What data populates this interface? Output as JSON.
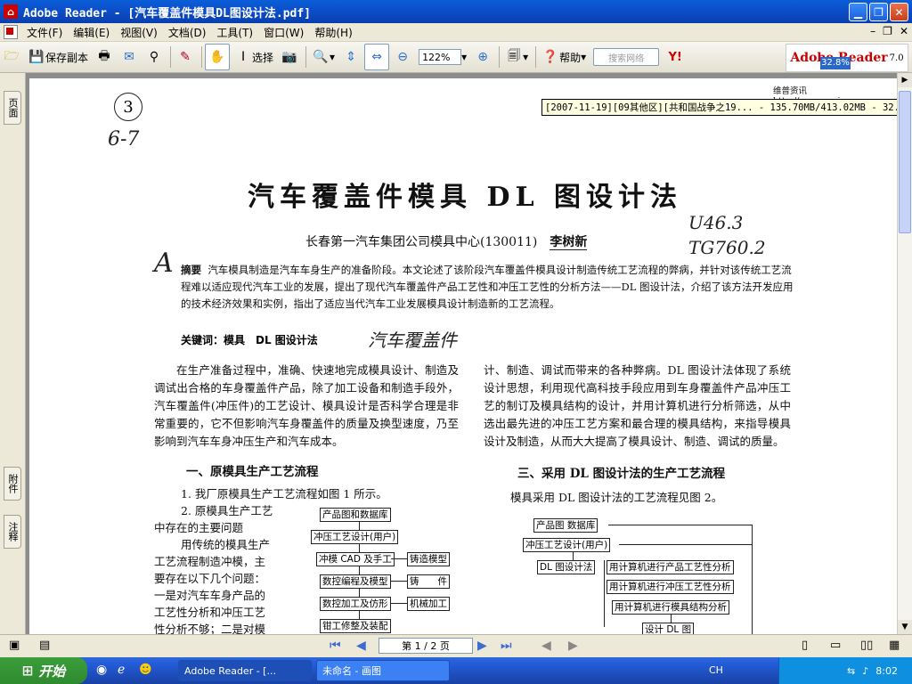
{
  "window": {
    "title": "Adobe Reader - [汽车覆盖件模具DL图设计法.pdf]"
  },
  "menu": [
    "文件(F)",
    "编辑(E)",
    "视图(V)",
    "文档(D)",
    "工具(T)",
    "窗口(W)",
    "帮助(H)"
  ],
  "toolbar": {
    "save_copy": "保存副本",
    "select": "选择",
    "zoom": "122%",
    "help": "帮助",
    "search_placeholder": "搜索网络",
    "logo_brand": "Adobe Reader",
    "logo_version": "7.0"
  },
  "side_tabs": [
    "页面",
    "附件",
    "注释"
  ],
  "overlay": {
    "zoom_indicator": "32.8%",
    "tooltip": "[2007-11-19][09其他区][共和国战争之19... - 135.70MB/413.02MB - 32.8%]",
    "vip_site": "维普资讯 http://www.cqvip.com"
  },
  "handwriting": {
    "circled": "3",
    "page_range": "6-7",
    "code1": "U46.3",
    "code2": "TG760.2",
    "letter": "A",
    "keyword_note": "汽车覆盖件"
  },
  "paper": {
    "title": "汽车覆盖件模具 DL 图设计法",
    "affiliation": "长春第一汽车集团公司模具中心(130011)",
    "author": "李树新",
    "abstract_label": "摘要",
    "abstract": "汽车模具制造是汽车车身生产的准备阶段。本文论述了该阶段汽车覆盖件模具设计制造传统工艺流程的弊病，并针对该传统工艺流程难以适应现代汽车工业的发展，提出了现代汽车覆盖件产品工艺性和冲压工艺性的分析方法——DL 图设计法，介绍了该方法开发应用的技术经济效果和实例，指出了适应当代汽车工业发展模具设计制造新的工艺流程。",
    "keywords": "关键词：模具　DL 图设计法",
    "intro_left": "在生产准备过程中，准确、快速地完成模具设计、制造及调试出合格的车身覆盖件产品，除了加工设备和制造手段外，汽车覆盖件(冲压件)的工艺设计、模具设计是否科学合理是非常重要的，它不但影响汽车身覆盖件的质量及换型速度，乃至影响到汽车车身冲压生产和汽车成本。",
    "intro_right": "计、制造、调试而带来的各种弊病。DL 图设计法体现了系统设计思想，利用现代高科技手段应用到车身覆盖件产品冲压工艺的制订及模具结构的设计，并用计算机进行分析筛选，从中选出最先进的冲压工艺方案和最合理的模具结构，来指导模具设计及制造，从而大大提高了模具设计、制造、调试的质量。",
    "sec1": "一、原模具生产工艺流程",
    "sec1_p1": "1. 我厂原模具生产工艺流程如图 1 所示。",
    "sec1_p2a": "2. 原模具生产工艺",
    "sec1_p2b": "中存在的主要问题",
    "sec1_p3": [
      "用传统的模具生产",
      "工艺流程制造冲模，主",
      "要存在以下几个问题：",
      "一是对汽车车身产品的",
      "工艺性分析和冲压工艺",
      "性分析不够；二是对模"
    ],
    "sec3": "三、采用 DL 图设计法的生产工艺流程",
    "sec3_p1": "模具采用 DL 图设计法的工艺流程见图 2。",
    "fig1": [
      "产品图和数据库",
      "冲压工艺设计(用户)",
      "冲模 CAD 及手工",
      "铸造模型",
      "数控编程及模型",
      "铸　　件",
      "数控加工及仿形",
      "机械加工",
      "钳工修整及装配"
    ],
    "fig2": [
      "产品图 数据库",
      "冲压工艺设计(用户)",
      "DL 图设计法",
      "用计算机进行产品工艺性分析",
      "用计算机进行冲压工艺性分析",
      "用计算机进行模具结构分析",
      "设计 DL 图"
    ]
  },
  "status": {
    "page": "第 1 / 2 页"
  },
  "taskbar": {
    "start": "开始",
    "tasks": [
      "Adobe Reader - [...",
      "未命名 - 画图"
    ],
    "ime": "CH",
    "time": "8:02"
  }
}
